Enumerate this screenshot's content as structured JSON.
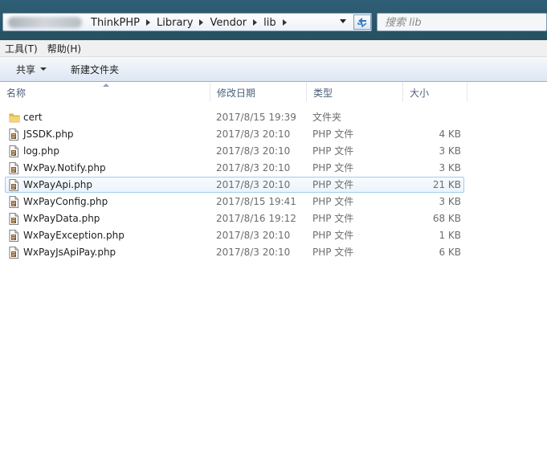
{
  "address": {
    "crumbs": [
      "ThinkPHP",
      "Library",
      "Vendor",
      "lib"
    ],
    "refresh_icon": "refresh-icon"
  },
  "search": {
    "placeholder": "搜索 lib"
  },
  "menu": {
    "tools": "工具(T)",
    "help": "帮助(H)"
  },
  "toolbar": {
    "share": "共享",
    "new_folder": "新建文件夹"
  },
  "columns": {
    "name": "名称",
    "date": "修改日期",
    "type": "类型",
    "size": "大小"
  },
  "files": [
    {
      "name": "cert",
      "date": "2017/8/15 19:39",
      "type": "文件夹",
      "size": "",
      "icon": "folder-icon"
    },
    {
      "name": "JSSDK.php",
      "date": "2017/8/3 20:10",
      "type": "PHP 文件",
      "size": "4 KB",
      "icon": "php-file-icon"
    },
    {
      "name": "log.php",
      "date": "2017/8/3 20:10",
      "type": "PHP 文件",
      "size": "3 KB",
      "icon": "php-file-icon"
    },
    {
      "name": "WxPay.Notify.php",
      "date": "2017/8/3 20:10",
      "type": "PHP 文件",
      "size": "3 KB",
      "icon": "php-file-icon"
    },
    {
      "name": "WxPayApi.php",
      "date": "2017/8/3 20:10",
      "type": "PHP 文件",
      "size": "21 KB",
      "icon": "php-file-icon"
    },
    {
      "name": "WxPayConfig.php",
      "date": "2017/8/15 19:41",
      "type": "PHP 文件",
      "size": "3 KB",
      "icon": "php-file-icon"
    },
    {
      "name": "WxPayData.php",
      "date": "2017/8/16 19:12",
      "type": "PHP 文件",
      "size": "68 KB",
      "icon": "php-file-icon"
    },
    {
      "name": "WxPayException.php",
      "date": "2017/8/3 20:10",
      "type": "PHP 文件",
      "size": "1 KB",
      "icon": "php-file-icon"
    },
    {
      "name": "WxPayJsApiPay.php",
      "date": "2017/8/3 20:10",
      "type": "PHP 文件",
      "size": "6 KB",
      "icon": "php-file-icon"
    }
  ],
  "selected_file": "WxPayApi.php"
}
